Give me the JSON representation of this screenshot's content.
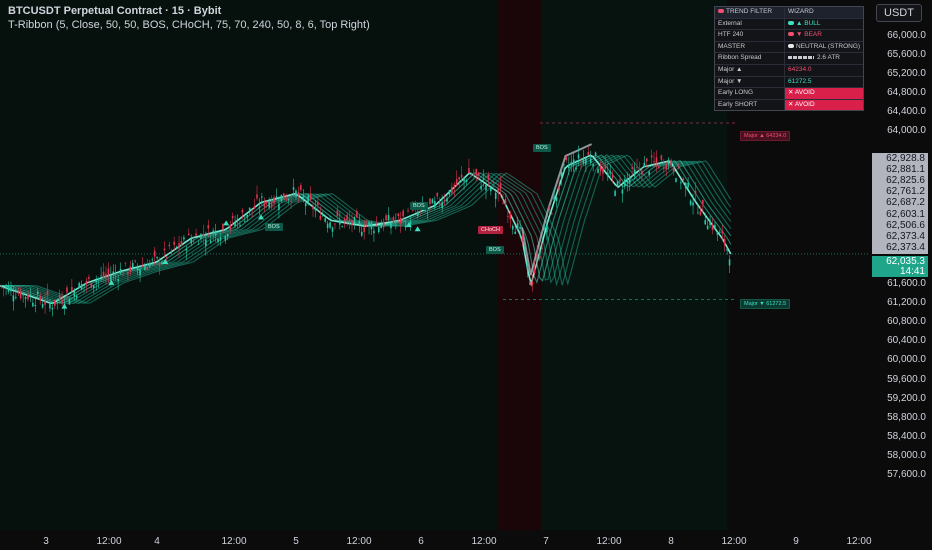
{
  "header": {
    "symbol_line": "BTCUSDT Perpetual Contract · 15 · Bybit",
    "indicator_line": "T-Ribbon (5, Close, 50, 50, BOS, CHoCH, 75, 70, 240, 50, 8, 6, Top Right)"
  },
  "currency_button": "USDT",
  "panel": {
    "header": {
      "left": "TREND FILTER",
      "right": "WIZARD"
    },
    "rows": [
      {
        "label": "External",
        "value": "▲ BULL",
        "style": "bull",
        "icon": "green-dot"
      },
      {
        "label": "HTF 240",
        "value": "▼ BEAR",
        "style": "bear",
        "icon": "red-dot"
      },
      {
        "label": "MASTER",
        "value": "NEUTRAL (STRONG)",
        "style": "neutral",
        "icon": "white-dot"
      },
      {
        "label": "Ribbon Spread",
        "value": "2.6 ATR",
        "style": "neutral",
        "icon": "spread-bar"
      },
      {
        "label": "Major ▲",
        "value": "64234.0",
        "style": "neg",
        "icon": ""
      },
      {
        "label": "Major ▼",
        "value": "61272.5",
        "style": "pos",
        "icon": ""
      },
      {
        "label": "Early LONG",
        "value": "✕ AVOID",
        "style": "red-bg",
        "icon": ""
      },
      {
        "label": "Early SHORT",
        "value": "✕ AVOID",
        "style": "red-bg",
        "icon": ""
      }
    ]
  },
  "price_axis": {
    "labels": [
      "66,000.0",
      "65,600.0",
      "65,200.0",
      "64,800.0",
      "64,400.0",
      "64,000.0",
      "61,600.0",
      "61,200.0",
      "60,800.0",
      "60,400.0",
      "60,000.0",
      "59,600.0",
      "59,200.0",
      "58,800.0",
      "58,400.0",
      "58,000.0",
      "57,600.0"
    ],
    "ribbon_values": [
      "62,928.8",
      "62,881.1",
      "62,825.6",
      "62,761.2",
      "62,687.2",
      "62,603.1",
      "62,506.6",
      "62,373.4",
      "62,373.4"
    ],
    "current_price": "62,035.3",
    "countdown": "14:41"
  },
  "time_axis": {
    "labels": [
      "3",
      "12:00",
      "4",
      "12:00",
      "5",
      "12:00",
      "6",
      "12:00",
      "7",
      "12:00",
      "8",
      "12:00",
      "9",
      "12:00"
    ]
  },
  "tags": {
    "major_up": "Major ▲ 64234.0",
    "major_down": "Major ▼ 61272.5",
    "bos": "BOS",
    "choch": "CHoCH"
  },
  "colors": {
    "bull": "#3fe0c0",
    "bear": "#f0506e",
    "background": "#0b0b0c"
  },
  "chart_data": {
    "type": "candlestick-ribbon",
    "x_labels": [
      "3",
      "12:00",
      "4",
      "12:00",
      "5",
      "12:00",
      "6",
      "12:00",
      "7",
      "12:00",
      "8",
      "12:00"
    ],
    "y_range": [
      57400,
      66300
    ],
    "close_path": [
      [
        0,
        61500
      ],
      [
        0.06,
        61200
      ],
      [
        0.1,
        61550
      ],
      [
        0.14,
        61750
      ],
      [
        0.18,
        61900
      ],
      [
        0.22,
        62300
      ],
      [
        0.26,
        62450
      ],
      [
        0.3,
        62900
      ],
      [
        0.34,
        63050
      ],
      [
        0.38,
        62600
      ],
      [
        0.42,
        62500
      ],
      [
        0.46,
        62600
      ],
      [
        0.5,
        62850
      ],
      [
        0.54,
        63400
      ],
      [
        0.575,
        63050
      ],
      [
        0.6,
        62300
      ],
      [
        0.61,
        61500
      ],
      [
        0.63,
        62600
      ],
      [
        0.65,
        63500
      ],
      [
        0.68,
        63700
      ],
      [
        0.71,
        63150
      ],
      [
        0.74,
        63500
      ],
      [
        0.77,
        63600
      ],
      [
        0.8,
        62900
      ],
      [
        0.83,
        62300
      ],
      [
        0.84,
        62035
      ]
    ],
    "major_high": 64234.0,
    "major_low": 61272.5,
    "current": 62035.3
  }
}
